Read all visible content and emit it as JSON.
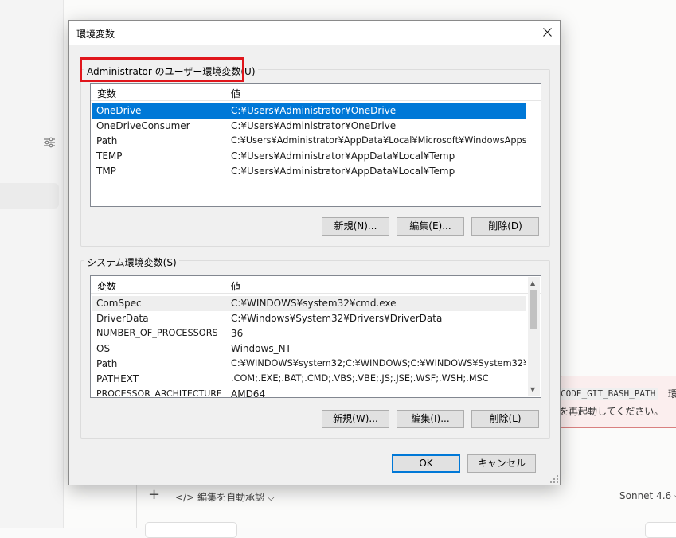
{
  "background": {
    "error_code": "CODE_GIT_BASH_PATH",
    "error_suffix": "環",
    "error_line2": "を再起動してください。",
    "auto_approve_label": "</> 編集を自動承認 ⌵",
    "plus_label": "+",
    "model_label": "Sonnet 4.6 ⌵"
  },
  "dialog": {
    "title": "環境変数",
    "user_section": {
      "label": "Administrator のユーザー環境変数(U)",
      "headers": [
        "変数",
        "値"
      ],
      "rows": [
        {
          "name": "OneDrive",
          "value": "C:¥Users¥Administrator¥OneDrive",
          "selected": true
        },
        {
          "name": "OneDriveConsumer",
          "value": "C:¥Users¥Administrator¥OneDrive"
        },
        {
          "name": "Path",
          "value": "C:¥Users¥Administrator¥AppData¥Local¥Microsoft¥WindowsApps;C..."
        },
        {
          "name": "TEMP",
          "value": "C:¥Users¥Administrator¥AppData¥Local¥Temp"
        },
        {
          "name": "TMP",
          "value": "C:¥Users¥Administrator¥AppData¥Local¥Temp"
        }
      ],
      "buttons": {
        "new": "新規(N)...",
        "edit": "編集(E)...",
        "delete": "削除(D)"
      }
    },
    "system_section": {
      "label": "システム環境変数(S)",
      "headers": [
        "変数",
        "値"
      ],
      "rows": [
        {
          "name": "ComSpec",
          "value": "C:¥WINDOWS¥system32¥cmd.exe"
        },
        {
          "name": "DriverData",
          "value": "C:¥Windows¥System32¥Drivers¥DriverData"
        },
        {
          "name": "NUMBER_OF_PROCESSORS",
          "value": "36"
        },
        {
          "name": "OS",
          "value": "Windows_NT"
        },
        {
          "name": "Path",
          "value": "C:¥WINDOWS¥system32;C:¥WINDOWS;C:¥WINDOWS¥System32¥W..."
        },
        {
          "name": "PATHEXT",
          "value": ".COM;.EXE;.BAT;.CMD;.VBS;.VBE;.JS;.JSE;.WSF;.WSH;.MSC"
        },
        {
          "name": "PROCESSOR_ARCHITECTURE",
          "value": "AMD64"
        }
      ],
      "buttons": {
        "new": "新規(W)...",
        "edit": "編集(I)...",
        "delete": "削除(L)"
      }
    },
    "ok_label": "OK",
    "cancel_label": "キャンセル"
  },
  "colors": {
    "selection": "#0078d7",
    "highlight_box": "#e0161c",
    "error_border": "#d98080"
  },
  "icons": [
    "filter-icon",
    "close-icon",
    "scroll-up-icon",
    "scroll-down-icon",
    "resize-grip-icon"
  ]
}
